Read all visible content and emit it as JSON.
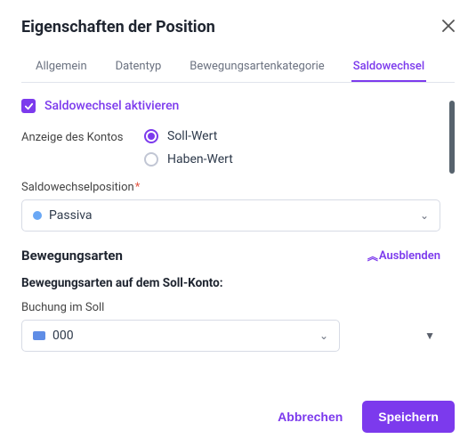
{
  "header": {
    "title": "Eigenschaften der Position"
  },
  "tabs": [
    {
      "label": "Allgemein",
      "active": false
    },
    {
      "label": "Datentyp",
      "active": false
    },
    {
      "label": "Bewegungsartenkategorie",
      "active": false
    },
    {
      "label": "Saldowechsel",
      "active": true
    }
  ],
  "enable": {
    "label": "Saldowechsel aktivieren",
    "checked": true
  },
  "account_display": {
    "label": "Anzeige des Kontos",
    "options": [
      {
        "label": "Soll-Wert",
        "selected": true
      },
      {
        "label": "Haben-Wert",
        "selected": false
      }
    ]
  },
  "position": {
    "label": "Saldowechselposition",
    "required_marker": "*",
    "value": "Passiva"
  },
  "movements": {
    "title": "Bewegungsarten",
    "toggle_label": "Ausblenden",
    "debit_section_label": "Bewegungsarten auf dem Soll-Konto:",
    "booking_label": "Buchung im Soll",
    "booking_value": "000"
  },
  "footer": {
    "cancel": "Abbrechen",
    "save": "Speichern"
  }
}
